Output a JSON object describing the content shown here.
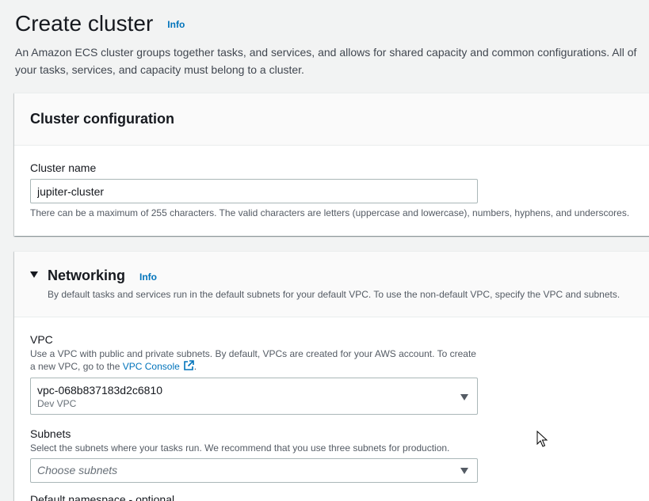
{
  "header": {
    "title": "Create cluster",
    "info_label": "Info",
    "description": "An Amazon ECS cluster groups together tasks, and services, and allows for shared capacity and common configurations. All of your tasks, services, and capacity must belong to a cluster."
  },
  "cluster_config": {
    "title": "Cluster configuration",
    "name_label": "Cluster name",
    "name_value": "jupiter-cluster",
    "name_help": "There can be a maximum of 255 characters. The valid characters are letters (uppercase and lowercase), numbers, hyphens, and underscores."
  },
  "networking": {
    "title": "Networking",
    "info_label": "Info",
    "description": "By default tasks and services run in the default subnets for your default VPC. To use the non-default VPC, specify the VPC and subnets.",
    "vpc": {
      "label": "VPC",
      "desc_line1": "Use a VPC with public and private subnets. By default, VPCs are created for your AWS account. To create",
      "desc_line2_prefix": "a new VPC, go to the",
      "console_link": "VPC Console",
      "desc_line2_suffix": ".",
      "selected_id": "vpc-068b837183d2c6810",
      "selected_name": "Dev VPC"
    },
    "subnets": {
      "label": "Subnets",
      "description": "Select the subnets where your tasks run. We recommend that you use three subnets for production.",
      "placeholder": "Choose subnets"
    },
    "namespace_label": "Default namespace - optional"
  },
  "colors": {
    "background": "#f2f3f3",
    "link": "#0073bb",
    "panel_header": "#fafafa",
    "text": "#16191f"
  },
  "icons": [
    "external-link-icon",
    "caret-down-icon",
    "dropdown-arrow-icon",
    "mouse-cursor-icon"
  ]
}
